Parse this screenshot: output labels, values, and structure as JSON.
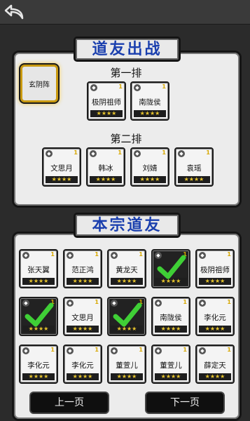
{
  "header": {
    "back_icon": "back-arrow-icon"
  },
  "top_section": {
    "title": "道友出战",
    "formation": "玄阴阵",
    "row1_label": "第一排",
    "row1": [
      {
        "name": "极阴祖师",
        "level": "1",
        "stars": "★★★★"
      },
      {
        "name": "南陇侯",
        "level": "1",
        "stars": "★★★★"
      }
    ],
    "row2_label": "第二排",
    "row2": [
      {
        "name": "文思月",
        "level": "1",
        "stars": "★★★★"
      },
      {
        "name": "韩冰",
        "level": "1",
        "stars": "★★★★"
      },
      {
        "name": "刘婧",
        "level": "1",
        "stars": "★★★★"
      },
      {
        "name": "袁瑶",
        "level": "1",
        "stars": "★★★★"
      }
    ]
  },
  "bottom_section": {
    "title": "本宗道友",
    "grid": [
      {
        "name": "张天翼",
        "level": "1",
        "stars": "★★★★",
        "selected": false
      },
      {
        "name": "范正鸿",
        "level": "1",
        "stars": "★★★★",
        "selected": false
      },
      {
        "name": "黄龙天",
        "level": "1",
        "stars": "★★★★",
        "selected": false
      },
      {
        "name": "",
        "level": "1",
        "stars": "★★★★",
        "selected": true
      },
      {
        "name": "极阴祖师",
        "level": "1",
        "stars": "★★★★",
        "selected": false
      },
      {
        "name": "",
        "level": "1",
        "stars": "★★★★",
        "selected": true
      },
      {
        "name": "文思月",
        "level": "1",
        "stars": "★★★★",
        "selected": false
      },
      {
        "name": "",
        "level": "1",
        "stars": "★★★★",
        "selected": true
      },
      {
        "name": "南陇侯",
        "level": "1",
        "stars": "★★★★",
        "selected": false
      },
      {
        "name": "李化元",
        "level": "1",
        "stars": "★★★★",
        "selected": false
      },
      {
        "name": "李化元",
        "level": "1",
        "stars": "★★★★",
        "selected": false
      },
      {
        "name": "李化元",
        "level": "1",
        "stars": "★★★★",
        "selected": false
      },
      {
        "name": "董萱儿",
        "level": "1",
        "stars": "★★★★",
        "selected": false
      },
      {
        "name": "董萱儿",
        "level": "1",
        "stars": "★★★★",
        "selected": false
      },
      {
        "name": "薛定天",
        "level": "1",
        "stars": "★★★★",
        "selected": false
      }
    ],
    "prev_page": "上一页",
    "next_page": "下一页"
  }
}
